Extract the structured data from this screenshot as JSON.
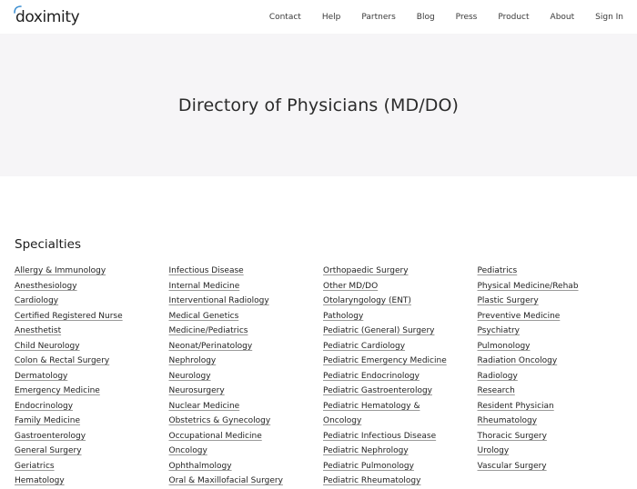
{
  "header": {
    "logo_text": "doximity",
    "nav": [
      "Contact",
      "Help",
      "Partners",
      "Blog",
      "Press",
      "Product",
      "About",
      "Sign In"
    ]
  },
  "hero": {
    "title": "Directory of Physicians (MD/DO)"
  },
  "specialties": {
    "title": "Specialties",
    "columns": [
      [
        "Allergy & Immunology",
        "Anesthesiology",
        "Cardiology",
        "Certified Registered Nurse",
        "Anesthetist",
        "Child Neurology",
        "Colon & Rectal Surgery",
        "Dermatology",
        "Emergency Medicine",
        "Endocrinology",
        "Family Medicine",
        "Gastroenterology",
        "General Surgery",
        "Geriatrics",
        "Hematology"
      ],
      [
        "Infectious Disease",
        "Internal Medicine",
        "Interventional Radiology",
        "Medical Genetics",
        "Medicine/Pediatrics",
        "Neonat/Perinatology",
        "Nephrology",
        "Neurology",
        "Neurosurgery",
        "Nuclear Medicine",
        "Obstetrics & Gynecology",
        "Occupational Medicine",
        "Oncology",
        "Ophthalmology",
        "Oral & Maxillofacial Surgery"
      ],
      [
        "Orthopaedic Surgery",
        "Other MD/DO",
        "Otolaryngology (ENT)",
        "Pathology",
        "Pediatric (General) Surgery",
        "Pediatric Cardiology",
        "Pediatric Emergency Medicine",
        "Pediatric Endocrinology",
        "Pediatric Gastroenterology",
        "Pediatric Hematology &",
        "Oncology",
        "Pediatric Infectious Disease",
        "Pediatric Nephrology",
        "Pediatric Pulmonology",
        "Pediatric Rheumatology"
      ],
      [
        "Pediatrics",
        "Physical Medicine/Rehab",
        "Plastic Surgery",
        "Preventive Medicine",
        "Psychiatry",
        "Pulmonology",
        "Radiation Oncology",
        "Radiology",
        "Research",
        "Resident Physician",
        "Rheumatology",
        "Thoracic Surgery",
        "Urology",
        "Vascular Surgery"
      ]
    ]
  },
  "colors": {
    "hero_bg": "#f6f5f7",
    "logo_accent": "#3d8fd1"
  }
}
